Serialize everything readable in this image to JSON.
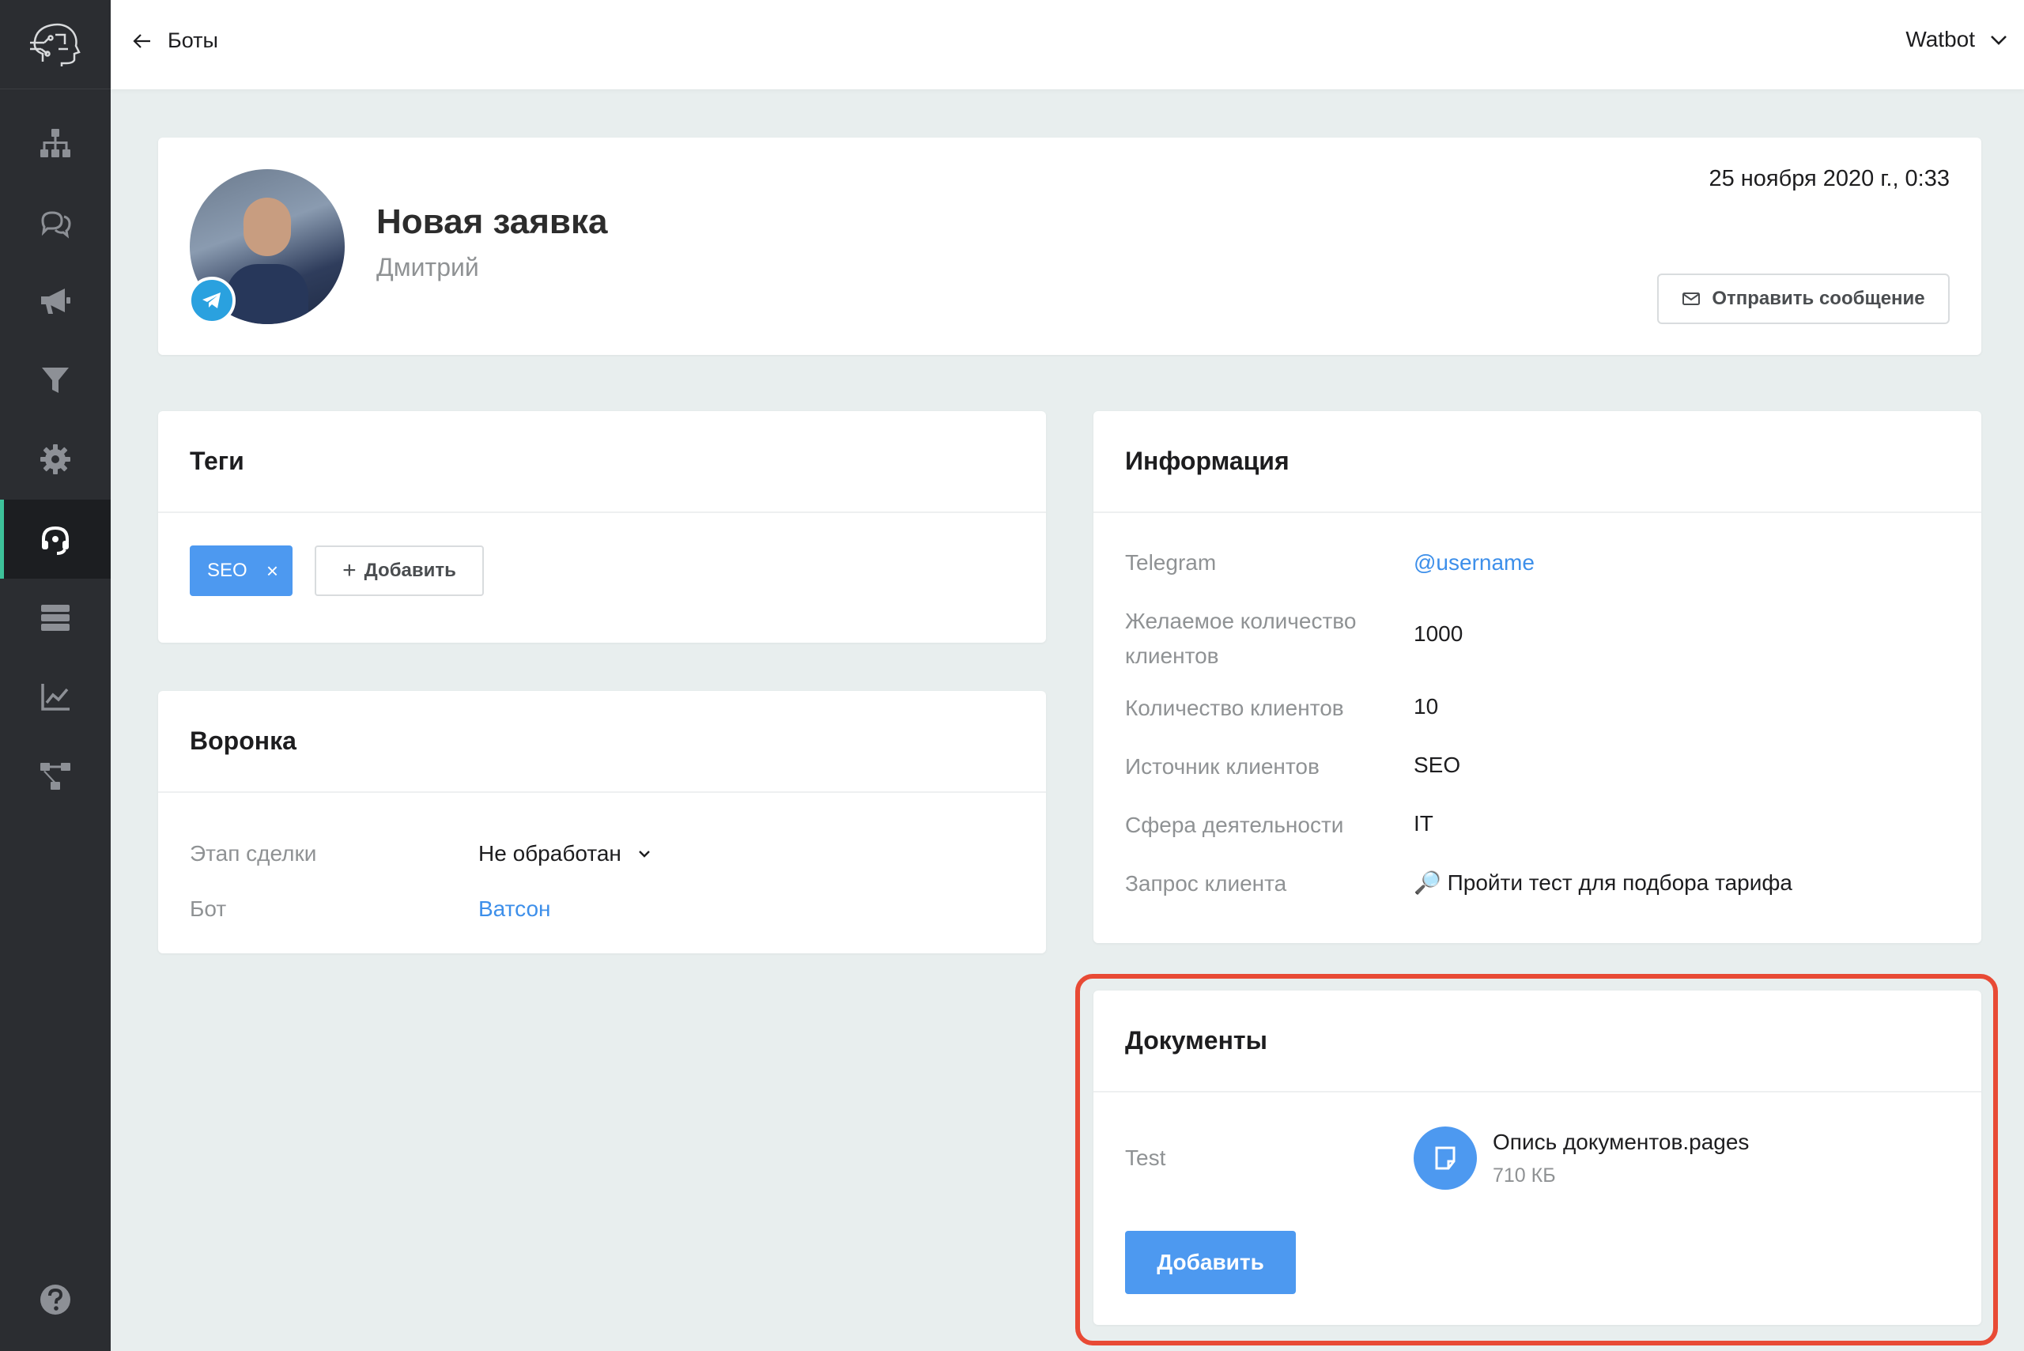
{
  "colors": {
    "sidebar_bg": "#2b2d31",
    "accent_blue": "#4d99f0",
    "link_blue": "#3d8fea",
    "active_indicator": "#3dc29a",
    "highlight_red": "#e84a35",
    "page_bg": "#e8eeee"
  },
  "sidebar": {
    "logo_icon": "robot-head-logo-icon",
    "items": [
      {
        "icon": "hierarchy-icon",
        "active": false
      },
      {
        "icon": "chat-bubbles-icon",
        "active": false
      },
      {
        "icon": "megaphone-icon",
        "active": false
      },
      {
        "icon": "funnel-icon",
        "active": false
      },
      {
        "icon": "gear-icon",
        "active": false
      },
      {
        "icon": "headset-icon",
        "active": true
      },
      {
        "icon": "database-icon",
        "active": false
      },
      {
        "icon": "line-chart-icon",
        "active": false
      },
      {
        "icon": "flow-icon",
        "active": false
      }
    ],
    "help_icon": "question-circle-icon"
  },
  "topbar": {
    "back_label": "Боты",
    "account_name": "Watbot"
  },
  "profile": {
    "title": "Новая заявка",
    "name": "Дмитрий",
    "date": "25 ноября 2020 г., 0:33",
    "send_message_label": "Отправить сообщение",
    "channel_icon": "telegram-icon"
  },
  "tags": {
    "heading": "Теги",
    "items": [
      "SEO"
    ],
    "add_label": "Добавить"
  },
  "funnel": {
    "heading": "Воронка",
    "stage_label": "Этап сделки",
    "stage_value": "Не обработан",
    "bot_label": "Бот",
    "bot_value": "Ватсон"
  },
  "info": {
    "heading": "Информация",
    "rows": [
      {
        "label": "Telegram",
        "value": "@username"
      },
      {
        "label": "Желаемое количество клиентов",
        "value": "1000"
      },
      {
        "label": "Количество клиентов",
        "value": "10"
      },
      {
        "label": "Источник клиентов",
        "value": "SEO"
      },
      {
        "label": "Сфера деятельности",
        "value": "IT"
      },
      {
        "label": "Запрос клиента",
        "value": "🔎 Пройти тест для подбора тарифа"
      }
    ]
  },
  "documents": {
    "heading": "Документы",
    "field_label": "Test",
    "file_name": "Опись документов.pages",
    "file_size": "710 КБ",
    "add_label": "Добавить"
  }
}
